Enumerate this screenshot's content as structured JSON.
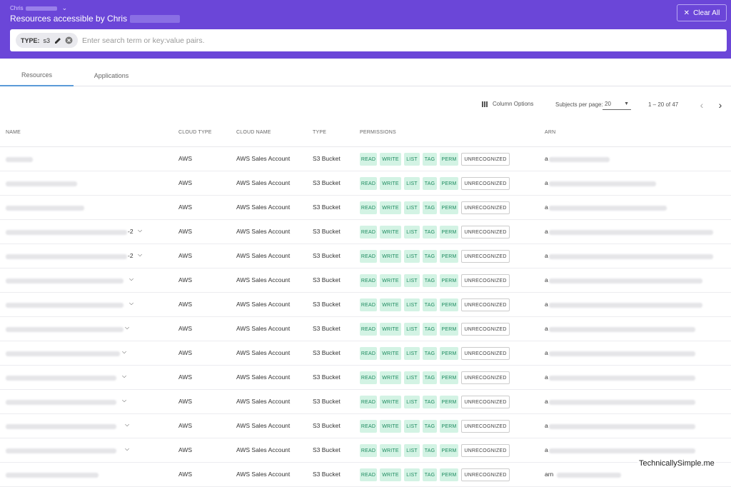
{
  "header": {
    "user_switch": "Chris",
    "title": "Resources accessible by Chris",
    "clear_all": "Clear All"
  },
  "search": {
    "chip_key": "TYPE:",
    "chip_value": "s3",
    "placeholder": "Enter search term or key:value pairs."
  },
  "tabs": [
    {
      "label": "Resources",
      "active": true
    },
    {
      "label": "Applications",
      "active": false
    }
  ],
  "toolbar": {
    "column_options": "Column Options",
    "per_page_label": "Subjects per page:",
    "per_page_value": "20",
    "range": "1 – 20 of 47"
  },
  "columns": [
    "NAME",
    "CLOUD TYPE",
    "CLOUD NAME",
    "TYPE",
    "PERMISSIONS",
    "ARN"
  ],
  "rows": [
    {
      "name_suffix": "",
      "cloud_type": "AWS",
      "cloud_name": "AWS Sales Account",
      "type": "S3 Bucket",
      "arn_prefix": "a"
    },
    {
      "name_suffix": "",
      "cloud_type": "AWS",
      "cloud_name": "AWS Sales Account",
      "type": "S3 Bucket",
      "arn_prefix": "a"
    },
    {
      "name_suffix": "",
      "cloud_type": "AWS",
      "cloud_name": "AWS Sales Account",
      "type": "S3 Bucket",
      "arn_prefix": "a"
    },
    {
      "name_suffix": "-2",
      "cloud_type": "AWS",
      "cloud_name": "AWS Sales Account",
      "type": "S3 Bucket",
      "arn_prefix": "a"
    },
    {
      "name_suffix": "-2",
      "cloud_type": "AWS",
      "cloud_name": "AWS Sales Account",
      "type": "S3 Bucket",
      "arn_prefix": "a"
    },
    {
      "name_suffix": "",
      "cloud_type": "AWS",
      "cloud_name": "AWS Sales Account",
      "type": "S3 Bucket",
      "arn_prefix": "a"
    },
    {
      "name_suffix": "",
      "cloud_type": "AWS",
      "cloud_name": "AWS Sales Account",
      "type": "S3 Bucket",
      "arn_prefix": "a"
    },
    {
      "name_suffix": "",
      "cloud_type": "AWS",
      "cloud_name": "AWS Sales Account",
      "type": "S3 Bucket",
      "arn_prefix": "a"
    },
    {
      "name_suffix": "",
      "cloud_type": "AWS",
      "cloud_name": "AWS Sales Account",
      "type": "S3 Bucket",
      "arn_prefix": "a"
    },
    {
      "name_suffix": "",
      "cloud_type": "AWS",
      "cloud_name": "AWS Sales Account",
      "type": "S3 Bucket",
      "arn_prefix": "a"
    },
    {
      "name_suffix": "",
      "cloud_type": "AWS",
      "cloud_name": "AWS Sales Account",
      "type": "S3 Bucket",
      "arn_prefix": "a"
    },
    {
      "name_suffix": "",
      "cloud_type": "AWS",
      "cloud_name": "AWS Sales Account",
      "type": "S3 Bucket",
      "arn_prefix": "a"
    },
    {
      "name_suffix": "",
      "cloud_type": "AWS",
      "cloud_name": "AWS Sales Account",
      "type": "S3 Bucket",
      "arn_prefix": "a"
    },
    {
      "name_suffix": "",
      "cloud_type": "AWS",
      "cloud_name": "AWS Sales Account",
      "type": "S3 Bucket",
      "arn_prefix": "arn"
    }
  ],
  "permissions": [
    "READ",
    "WRITE",
    "LIST",
    "TAG",
    "PERM",
    "UNRECOGNIZED"
  ],
  "watermark": "TechnicallySimple.me"
}
